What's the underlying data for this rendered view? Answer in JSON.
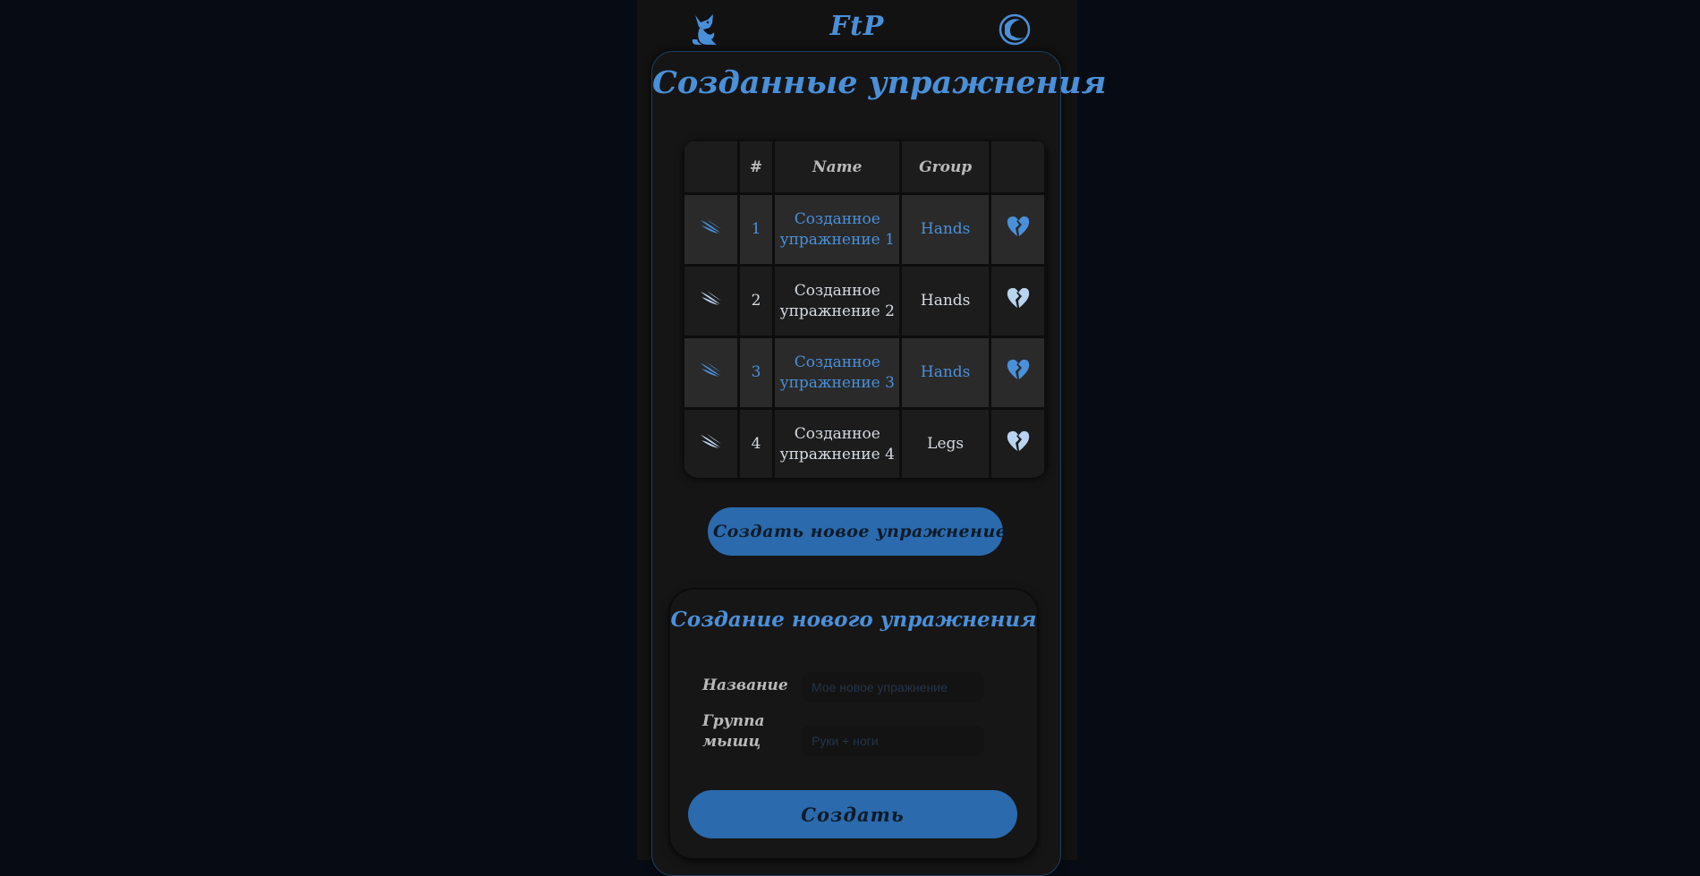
{
  "colors": {
    "accent": "#4a90d9",
    "button_bg": "#2a6aad",
    "background": "#070c14",
    "panel": "#151515"
  },
  "header": {
    "logo_icon": "fox-icon",
    "title": "FtP",
    "theme_icon": "moon-icon"
  },
  "page": {
    "title": "Созданные упражнения"
  },
  "table": {
    "columns": [
      "",
      "#",
      "Name",
      "Group",
      ""
    ],
    "rows": [
      {
        "icon": "swoosh-icon",
        "num": "1",
        "name": "Созданное упражнение 1",
        "group": "Hands",
        "fav_icon": "broken-heart-icon"
      },
      {
        "icon": "swoosh-icon",
        "num": "2",
        "name": "Созданное упражнение 2",
        "group": "Hands",
        "fav_icon": "broken-heart-icon"
      },
      {
        "icon": "swoosh-icon",
        "num": "3",
        "name": "Созданное упражнение 3",
        "group": "Hands",
        "fav_icon": "broken-heart-icon"
      },
      {
        "icon": "swoosh-icon",
        "num": "4",
        "name": "Созданное упражнение 4",
        "group": "Legs",
        "fav_icon": "broken-heart-icon"
      }
    ]
  },
  "create_button": {
    "label": "Создать новое упражнение"
  },
  "form": {
    "title": "Создание нового упражнения",
    "name_label": "Название",
    "name_placeholder": "Мое новое упражнение",
    "name_value": "",
    "group_label": "Группа мышц",
    "group_placeholder": "Руки + ноги",
    "group_value": "",
    "submit_label": "Создать"
  }
}
